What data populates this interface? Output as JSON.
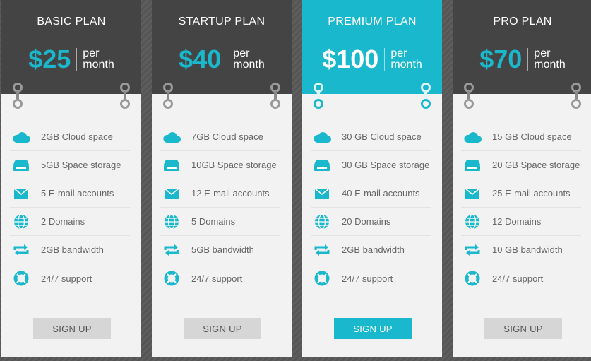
{
  "accent_color": "#1ab8cc",
  "header_color": "#444444",
  "plans": [
    {
      "name": "BASIC PLAN",
      "price": "$25",
      "per_line1": "per",
      "per_line2": "month",
      "signup": "SIGN UP",
      "features": [
        "2GB Cloud space",
        "5GB Space storage",
        "5 E-mail accounts",
        "2 Domains",
        "2GB bandwidth",
        "24/7 support"
      ]
    },
    {
      "name": "STARTUP PLAN",
      "price": "$40",
      "per_line1": "per",
      "per_line2": "month",
      "signup": "SIGN UP",
      "features": [
        "7GB Cloud space",
        "10GB Space storage",
        "12 E-mail accounts",
        "5 Domains",
        "5GB bandwidth",
        "24/7 support"
      ]
    },
    {
      "name": "PREMIUM PLAN",
      "price": "$100",
      "per_line1": "per",
      "per_line2": "month",
      "signup": "SIGN UP",
      "features": [
        "30 GB Cloud space",
        "30 GB Space storage",
        "40 E-mail accounts",
        "20 Domains",
        "2GB bandwidth",
        "24/7 support"
      ]
    },
    {
      "name": "PRO PLAN",
      "price": "$70",
      "per_line1": "per",
      "per_line2": "month",
      "signup": "SIGN UP",
      "features": [
        "15 GB Cloud space",
        "20 GB Space storage",
        "25 E-mail accounts",
        "12 Domains",
        "10 GB bandwidth",
        "24/7 support"
      ]
    }
  ],
  "feature_icons": [
    "cloud-icon",
    "storage-icon",
    "envelope-icon",
    "globe-icon",
    "repeat-icon",
    "lifebuoy-icon"
  ]
}
